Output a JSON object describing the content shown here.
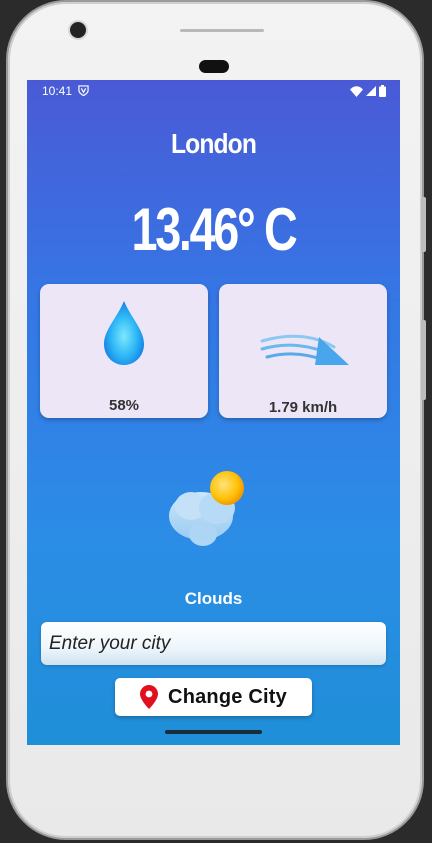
{
  "status_bar": {
    "time": "10:41",
    "shield_icon": "shield-v-icon",
    "wifi_icon": "wifi-icon",
    "signal_icon": "signal-icon",
    "battery_icon": "battery-icon"
  },
  "weather": {
    "city": "London",
    "temperature": "13.46° C",
    "humidity": "58%",
    "humidity_icon": "water-drop-icon",
    "wind_speed": "1.79 km/h",
    "wind_icon": "wind-icon",
    "condition_icon": "cloud-sun-icon",
    "description": "Clouds"
  },
  "search": {
    "placeholder": "Enter your city",
    "value": ""
  },
  "actions": {
    "change_city_label": "Change City",
    "change_city_icon": "location-pin-icon"
  },
  "colors": {
    "gradient_top": "#4a5ad6",
    "gradient_bottom": "#1f8fd8",
    "card_bg": "#ede6f7",
    "pin_red": "#e0101e",
    "sun_yellow": "#ffc107",
    "drop_blue": "#2bb5f5"
  }
}
